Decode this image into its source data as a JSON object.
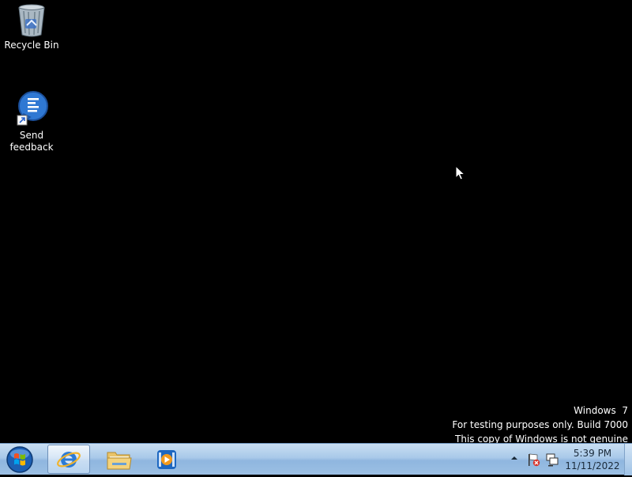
{
  "desktop": {
    "icons": [
      {
        "label": "Recycle Bin",
        "icon": "recycle-bin-icon"
      },
      {
        "label": "Send feedback",
        "icon": "send-feedback-icon"
      }
    ]
  },
  "watermark": {
    "line1": "Windows  7",
    "line2": "For testing purposes only. Build 7000",
    "line3": "This copy of Windows is not genuine"
  },
  "taskbar": {
    "start": "start-orb-icon",
    "pinned": [
      {
        "name": "Internet Explorer",
        "icon": "internet-explorer-icon",
        "active": true
      },
      {
        "name": "Windows Explorer",
        "icon": "folder-icon",
        "active": false
      },
      {
        "name": "Windows Media Player",
        "icon": "media-player-icon",
        "active": false
      }
    ],
    "tray": {
      "icons": [
        "show-hidden-icons-arrow",
        "action-center-flag-icon",
        "network-icon"
      ]
    },
    "clock": {
      "time": "5:39 PM",
      "date": "11/11/2022"
    }
  },
  "colors": {
    "desktop_background": "#000000",
    "taskbar_top": "#c9dff3",
    "taskbar_bottom": "#9cc0e4"
  }
}
